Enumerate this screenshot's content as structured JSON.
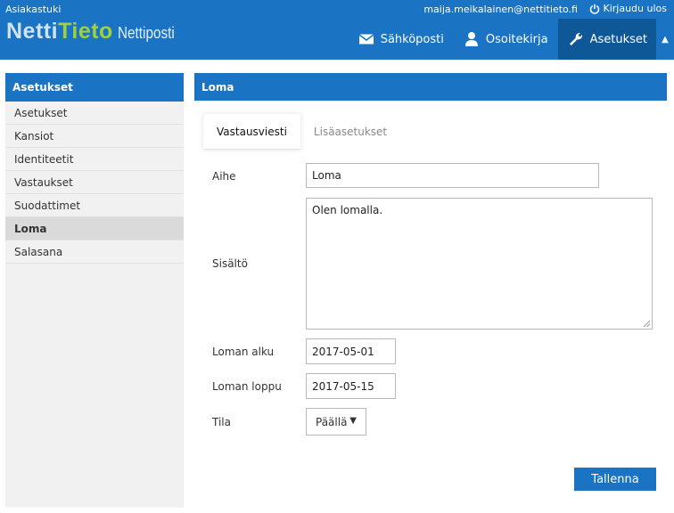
{
  "header": {
    "support_link": "Asiakastuki",
    "user_email": "maija.meikalainen@nettitieto.fi",
    "logout_label": "Kirjaudu ulos",
    "logo": {
      "part1": "Netti",
      "part2": "Tieto",
      "part3": "Nettiposti"
    },
    "nav": [
      {
        "label": "Sähköposti",
        "icon": "envelope-icon"
      },
      {
        "label": "Osoitekirja",
        "icon": "person-icon"
      },
      {
        "label": "Asetukset",
        "icon": "wrench-icon"
      }
    ]
  },
  "sidebar": {
    "title": "Asetukset",
    "items": [
      {
        "label": "Asetukset"
      },
      {
        "label": "Kansiot"
      },
      {
        "label": "Identiteetit"
      },
      {
        "label": "Vastaukset"
      },
      {
        "label": "Suodattimet"
      },
      {
        "label": "Loma",
        "active": true
      },
      {
        "label": "Salasana"
      }
    ]
  },
  "panel": {
    "title": "Loma",
    "tabs": [
      "Vastausviesti",
      "Lisäasetukset"
    ],
    "form": {
      "subject_label": "Aihe",
      "subject_value": "Loma",
      "body_label": "Sisältö",
      "body_value": "Olen lomalla.",
      "start_label": "Loman alku",
      "start_value": "2017-05-01",
      "end_label": "Loman loppu",
      "end_value": "2017-05-15",
      "status_label": "Tila",
      "status_value": "Päällä"
    },
    "save_label": "Tallenna"
  },
  "colors": {
    "primary": "#1a73c3",
    "active_nav": "#0f5898",
    "logo_green": "#9fd13e"
  }
}
